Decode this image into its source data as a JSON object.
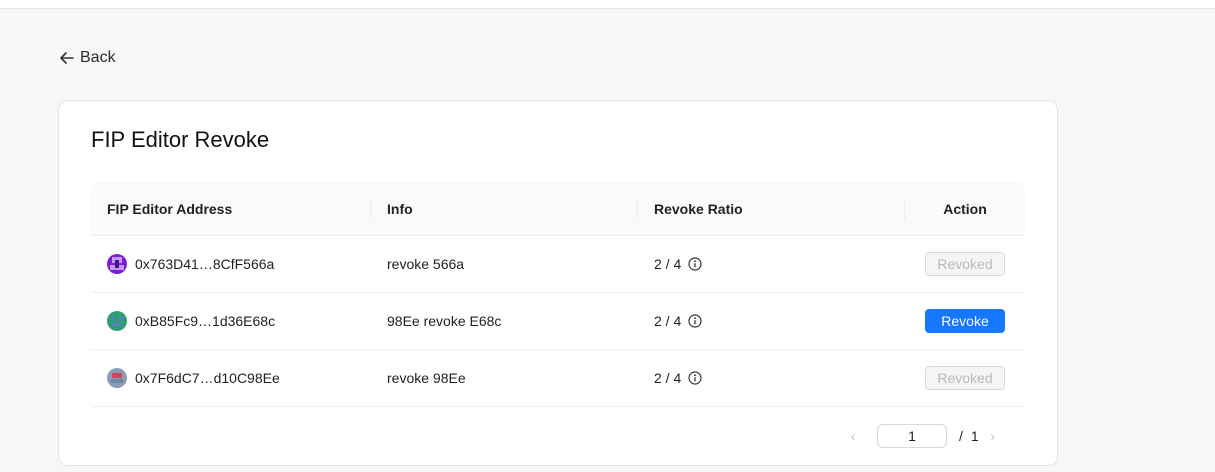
{
  "nav": {
    "back_label": "Back"
  },
  "card": {
    "title": "FIP Editor Revoke"
  },
  "table": {
    "columns": [
      "FIP Editor Address",
      "Info",
      "Revoke Ratio",
      "Action"
    ],
    "rows": [
      {
        "address": "0x763D41…8CfF566a",
        "info": "revoke 566a",
        "ratio": "2 / 4",
        "action": "Revoked",
        "action_enabled": false
      },
      {
        "address": "0xB85Fc9…1d36E68c",
        "info": "98Ee revoke E68c",
        "ratio": "2 / 4",
        "action": "Revoke",
        "action_enabled": true
      },
      {
        "address": "0x7F6dC7…d10C98Ee",
        "info": "revoke 98Ee",
        "ratio": "2 / 4",
        "action": "Revoked",
        "action_enabled": false
      }
    ]
  },
  "pagination": {
    "current": "1",
    "separator": "/",
    "total": "1"
  },
  "colors": {
    "primary": "#1677ff",
    "avatar_1": "#7b1fd6",
    "avatar_2": "#2e9e6e",
    "avatar_3": "#8a9fb5"
  }
}
